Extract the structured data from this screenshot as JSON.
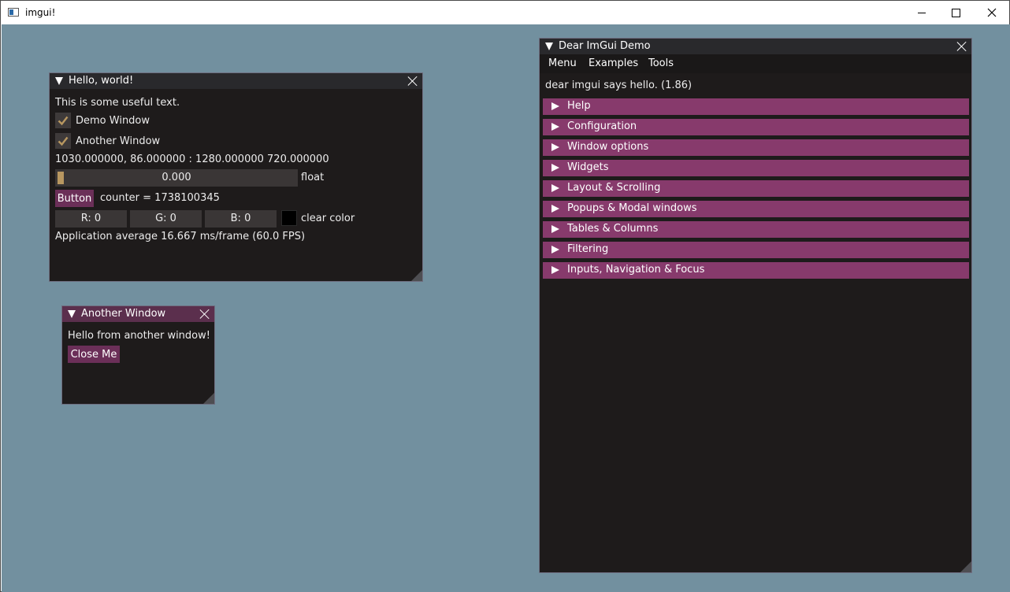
{
  "os_window": {
    "title": "imgui!"
  },
  "hello_window": {
    "title": "Hello, world!",
    "text": "This is some useful text.",
    "checkbox_demo": {
      "label": "Demo Window",
      "checked": true
    },
    "checkbox_another": {
      "label": "Another Window",
      "checked": true
    },
    "rect_info": "1030.000000, 86.000000 : 1280.000000 720.000000",
    "slider": {
      "value": "0.000",
      "label": "float"
    },
    "button_label": "Button",
    "counter_text": "counter = 1738100345",
    "color": {
      "r": "R:  0",
      "g": "G:  0",
      "b": "B:  0",
      "swatch": "#000000",
      "label": "clear color"
    },
    "fps_text": "Application average 16.667 ms/frame (60.0 FPS)"
  },
  "another_window": {
    "title": "Another Window",
    "text": "Hello from another window!",
    "close_button": "Close Me"
  },
  "demo_window": {
    "title": "Dear ImGui Demo",
    "menu": [
      "Menu",
      "Examples",
      "Tools"
    ],
    "hello_text": "dear imgui says hello. (1.86)",
    "headers": [
      "Help",
      "Configuration",
      "Window options",
      "Widgets",
      "Layout & Scrolling",
      "Popups & Modal windows",
      "Tables & Columns",
      "Filtering",
      "Inputs, Navigation & Focus"
    ]
  },
  "colors": {
    "viewport_bg": "#72909f",
    "window_bg": "#1e1b1b",
    "header": "#873a6c",
    "button": "#6b2f58",
    "checkmark": "#b89760"
  }
}
